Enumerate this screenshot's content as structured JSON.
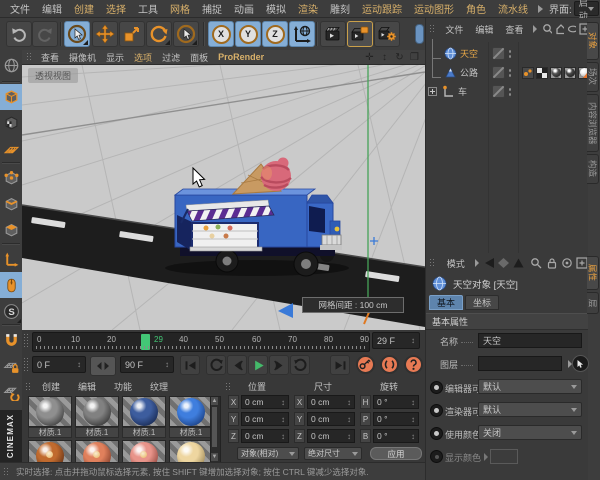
{
  "menubar": {
    "items": [
      {
        "label": "文件",
        "accent": false
      },
      {
        "label": "编辑",
        "accent": false
      },
      {
        "label": "创建",
        "accent": true
      },
      {
        "label": "选择",
        "accent": true
      },
      {
        "label": "工具",
        "accent": false
      },
      {
        "label": "网格",
        "accent": true
      },
      {
        "label": "捕捉",
        "accent": false
      },
      {
        "label": "动画",
        "accent": false
      },
      {
        "label": "模拟",
        "accent": false
      },
      {
        "label": "渲染",
        "accent": true
      },
      {
        "label": "雕刻",
        "accent": false
      },
      {
        "label": "运动跟踪",
        "accent": true
      },
      {
        "label": "运动图形",
        "accent": true
      },
      {
        "label": "角色",
        "accent": true
      },
      {
        "label": "流水线",
        "accent": true
      }
    ],
    "interface_label": "界面:",
    "interface_value": "启动"
  },
  "toolbar": {
    "axis_x": "X",
    "axis_y": "Y",
    "axis_z": "Z",
    "snap_letter": "S"
  },
  "viewport": {
    "menu": [
      {
        "label": "查看",
        "accent": false
      },
      {
        "label": "摄像机",
        "accent": false
      },
      {
        "label": "显示",
        "accent": false
      },
      {
        "label": "选项",
        "accent": true
      },
      {
        "label": "过滤",
        "accent": false
      },
      {
        "label": "面板",
        "accent": false
      },
      {
        "label": "ProRender",
        "accent": true
      }
    ],
    "view_label": "透视视图",
    "grid_tooltip": "网格间距 : 100 cm"
  },
  "object_manager": {
    "menus": [
      "文件",
      "编辑",
      "查看"
    ],
    "objects": [
      {
        "name": "天空",
        "selected": true
      },
      {
        "name": "公路",
        "selected": false
      },
      {
        "name": "车",
        "selected": false
      }
    ],
    "side_tabs": [
      {
        "label": "对象",
        "active": true
      },
      {
        "label": "场次",
        "active": false
      },
      {
        "label": "内容浏览器",
        "active": false
      },
      {
        "label": "构造",
        "active": false
      }
    ]
  },
  "attributes": {
    "menu_label": "模式",
    "title": "天空对象 [天空]",
    "tabs": [
      {
        "label": "基本",
        "active": true
      },
      {
        "label": "坐标",
        "active": false
      }
    ],
    "section": "基本属性",
    "name_label": "名称",
    "name_value": "天空",
    "layer_label": "图层",
    "rows": [
      {
        "label": "编辑器可见",
        "value": "默认"
      },
      {
        "label": "渲染器可见",
        "value": "默认"
      },
      {
        "label": "使用颜色",
        "value": "关闭"
      }
    ],
    "display_color_label": "显示颜色",
    "side_tabs": [
      {
        "label": "属性",
        "active": true
      },
      {
        "label": "层",
        "active": false
      }
    ]
  },
  "timeline": {
    "tick_labels": [
      "0",
      "10",
      "20",
      "40",
      "50",
      "60",
      "70",
      "80",
      "90"
    ],
    "playhead_label": "29",
    "frame_field": "29 F",
    "range_start": "0 F",
    "range_end": "90 F"
  },
  "materials": {
    "menus": [
      "创建",
      "编辑",
      "功能",
      "纹理"
    ],
    "items": [
      {
        "name": "材质.1",
        "color": "#8f8f8f",
        "shade": "#2b2b2b"
      },
      {
        "name": "材质.1",
        "color": "#818181",
        "shade": "#262626"
      },
      {
        "name": "材质.1",
        "color": "#3d5d9e",
        "shade": "#101e42"
      },
      {
        "name": "材质.1",
        "color": "#3f7ede",
        "shade": "#12316e"
      },
      {
        "name": "",
        "color": "#c06a2e",
        "shade": "#4e2410"
      },
      {
        "name": "",
        "color": "#e0805c",
        "shade": "#6e3020"
      },
      {
        "name": "",
        "color": "#e8948a",
        "shade": "#7e342c"
      },
      {
        "name": "",
        "color": "#eed6a0",
        "shade": "#8a7646"
      }
    ]
  },
  "coords": {
    "headers": [
      "位置",
      "尺寸",
      "旋转"
    ],
    "rows": [
      {
        "a1": "X",
        "v1": "0 cm",
        "a2": "X",
        "v2": "0 cm",
        "a3": "H",
        "v3": "0 °"
      },
      {
        "a1": "Y",
        "v1": "0 cm",
        "a2": "Y",
        "v2": "0 cm",
        "a3": "P",
        "v3": "0 °"
      },
      {
        "a1": "Z",
        "v1": "0 cm",
        "a2": "Z",
        "v2": "0 cm",
        "a3": "B",
        "v3": "0 °"
      }
    ],
    "mode_object": "对象(相对)",
    "mode_size": "绝对尺寸",
    "apply": "应用"
  },
  "statusbar": {
    "text": "实时选择: 点击并拖动鼠标选择元素, 按住 SHIFT 键增加选择对象; 按住 CTRL 键减少选择对象."
  },
  "branding": {
    "line1": "MAX",
    "line2": "CINE"
  }
}
